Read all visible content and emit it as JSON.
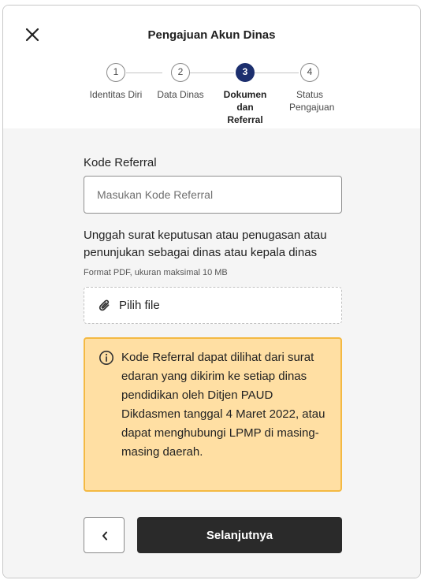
{
  "header": {
    "title": "Pengajuan Akun Dinas",
    "close_icon": "close-icon"
  },
  "stepper": {
    "current_step": 3,
    "steps": [
      {
        "number": "1",
        "label": "Identitas Diri",
        "state": "inactive"
      },
      {
        "number": "2",
        "label": "Data Dinas",
        "state": "inactive"
      },
      {
        "number": "3",
        "label": "Dokumen dan Referral",
        "state": "active"
      },
      {
        "number": "4",
        "label": "Status Pengajuan",
        "state": "inactive"
      }
    ]
  },
  "form": {
    "referral": {
      "label": "Kode Referral",
      "placeholder": "Masukan Kode Referral",
      "value": ""
    },
    "upload": {
      "description": "Unggah surat keputusan atau penugasan atau penunjukan sebagai dinas atau kepala dinas",
      "hint": "Format PDF, ukuran maksimal 10 MB",
      "button_label": "Pilih file",
      "icon": "paperclip-icon"
    },
    "info": {
      "icon": "info-icon",
      "text": "Kode Referral dapat dilihat dari surat edaran yang dikirim ke setiap dinas pendidikan oleh Ditjen PAUD Dikdasmen tanggal 4 Maret 2022, atau dapat menghubungi LPMP di masing-masing daerah."
    }
  },
  "footer": {
    "back_icon": "chevron-left-icon",
    "next_label": "Selanjutnya"
  },
  "colors": {
    "active_step": "#1c2f6e",
    "info_background": "#ffdfa3",
    "info_border": "#f4b942",
    "primary_button": "#2a2a2a",
    "content_background": "#f5f5f5"
  }
}
